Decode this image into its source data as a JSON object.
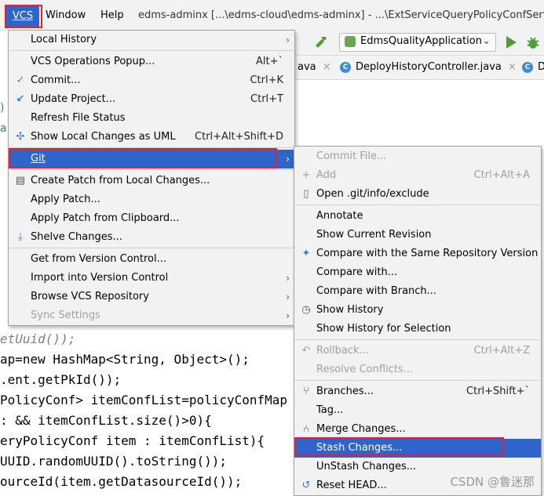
{
  "menubar": {
    "vcs": "VCS",
    "window": "Window",
    "help": "Help",
    "title": "edms-adminx [...\\edms-cloud\\edms-adminx] - ...\\ExtServiceQueryPolicyConfService"
  },
  "toolbar": {
    "run_config": "EdmsQualityApplication"
  },
  "tabs": {
    "left_partial": "ava",
    "active": "DeployHistoryController.java",
    "right_partial": "D"
  },
  "code_lines": [
    "etUuid());",
    "ap=new HashMap<String, Object>();",
    ".ent.getPkId());",
    "PolicyConf> itemConfList=policyConfMap",
    ": && itemConfList.size()>0){",
    "eryPolicyConf item : itemConfList){",
    "UUID.randomUUID().toString());",
    "ourceId(item.getDatasourceId());"
  ],
  "vcs_menu": {
    "items": [
      {
        "label": "Local History",
        "shortcut": "",
        "submenu": true
      },
      {
        "label": "VCS Operations Popup...",
        "shortcut": "Alt+`"
      },
      {
        "label": "Commit...",
        "shortcut": "Ctrl+K",
        "icon": "check-icon"
      },
      {
        "label": "Update Project...",
        "shortcut": "Ctrl+T",
        "icon": "update-arrow-icon"
      },
      {
        "label": "Refresh File Status",
        "shortcut": ""
      },
      {
        "label": "Show Local Changes as UML",
        "shortcut": "Ctrl+Alt+Shift+D",
        "icon": "uml-icon"
      },
      {
        "label": "Git",
        "shortcut": "",
        "submenu": true,
        "highlighted": true
      },
      {
        "label": "Create Patch from Local Changes...",
        "shortcut": "",
        "icon": "patch-icon"
      },
      {
        "label": "Apply Patch...",
        "shortcut": ""
      },
      {
        "label": "Apply Patch from Clipboard...",
        "shortcut": ""
      },
      {
        "label": "Shelve Changes...",
        "shortcut": "",
        "icon": "shelve-icon"
      },
      {
        "label": "Get from Version Control...",
        "shortcut": ""
      },
      {
        "label": "Import into Version Control",
        "shortcut": "",
        "submenu": true
      },
      {
        "label": "Browse VCS Repository",
        "shortcut": "",
        "submenu": true
      },
      {
        "label": "Sync Settings",
        "shortcut": "",
        "submenu": true,
        "disabled": true
      }
    ]
  },
  "git_menu": {
    "items": [
      {
        "label": "Commit File...",
        "shortcut": "",
        "disabled": true
      },
      {
        "label": "Add",
        "shortcut": "Ctrl+Alt+A",
        "disabled": true,
        "icon": "plus-icon"
      },
      {
        "label": "Open .git/info/exclude",
        "shortcut": "",
        "icon": "file-icon"
      },
      {
        "label": "Annotate",
        "shortcut": ""
      },
      {
        "label": "Show Current Revision",
        "shortcut": ""
      },
      {
        "label": "Compare with the Same Repository Version",
        "shortcut": "",
        "icon": "compare-icon"
      },
      {
        "label": "Compare with...",
        "shortcut": ""
      },
      {
        "label": "Compare with Branch...",
        "shortcut": ""
      },
      {
        "label": "Show History",
        "shortcut": "",
        "icon": "clock-icon"
      },
      {
        "label": "Show History for Selection",
        "shortcut": ""
      },
      {
        "label": "Rollback...",
        "shortcut": "Ctrl+Alt+Z",
        "disabled": true,
        "icon": "rollback-icon"
      },
      {
        "label": "Resolve Conflicts...",
        "shortcut": "",
        "disabled": true
      },
      {
        "label": "Branches...",
        "shortcut": "Ctrl+Shift+`",
        "icon": "branch-icon"
      },
      {
        "label": "Tag...",
        "shortcut": ""
      },
      {
        "label": "Merge Changes...",
        "shortcut": "",
        "icon": "merge-icon"
      },
      {
        "label": "Stash Changes...",
        "shortcut": "",
        "highlighted": true
      },
      {
        "label": "UnStash Changes...",
        "shortcut": ""
      },
      {
        "label": "Reset HEAD...",
        "shortcut": "",
        "icon": "reset-icon"
      }
    ]
  },
  "watermark": "CSDN @鲁迷那",
  "colors": {
    "highlight": "#2f65ca",
    "annotation_border": "#e8222a",
    "menu_bg": "#f2f2f2"
  }
}
